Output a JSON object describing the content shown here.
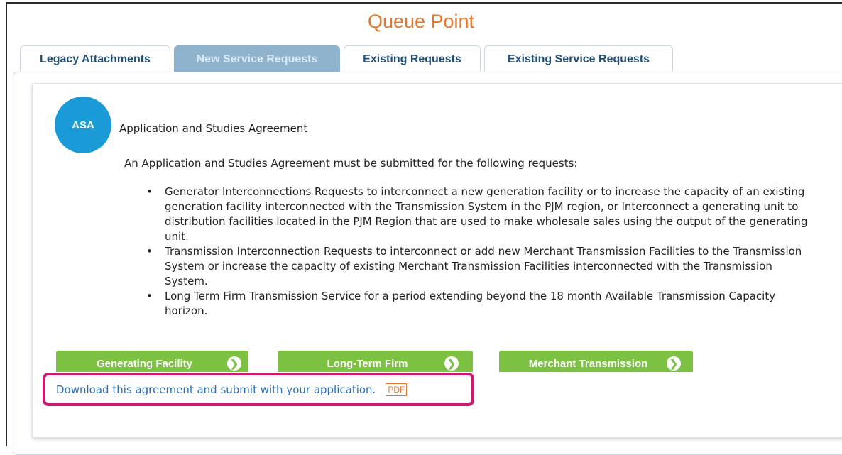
{
  "page": {
    "title": "Queue Point"
  },
  "tabs": [
    {
      "label": "Legacy Attachments",
      "active": false
    },
    {
      "label": "New Service Requests",
      "active": true
    },
    {
      "label": "Existing Requests",
      "active": false
    },
    {
      "label": "Existing Service Requests",
      "active": false
    }
  ],
  "asa": {
    "badge": "ASA",
    "title": "Application and Studies Agreement",
    "intro": "An Application and Studies Agreement must be submitted for the following requests:",
    "requests": [
      "Generator Interconnections Requests to interconnect a new generation facility or to increase the capacity of an existing generation facility interconnected with the Transmission System in the PJM region, or Interconnect a generating unit to distribution facilities located in the PJM Region that are used to make wholesale sales using the output of the generating unit.",
      "Transmission Interconnection Requests to interconnect or add new Merchant Transmission Facilities to the Transmission System or increase the capacity of existing Merchant Transmission Facilities interconnected with the Transmission System.",
      "Long Term Firm Transmission Service for a period extending beyond the 18 month Available Transmission Capacity horizon."
    ]
  },
  "buttons": {
    "generating": "Generating Facility",
    "long_term": "Long-Term Firm",
    "merchant": "Merchant Transmission",
    "icon": "chevron-right-icon"
  },
  "download": {
    "text": "Download this agreement and submit with your application.",
    "pdf": "PDF"
  },
  "colors": {
    "title": "#e8772e",
    "active_tab": "#8fb3cc",
    "badge": "#1a9ad6",
    "button": "#7cc142",
    "highlight": "#d0176f",
    "link": "#2a6eb5"
  }
}
